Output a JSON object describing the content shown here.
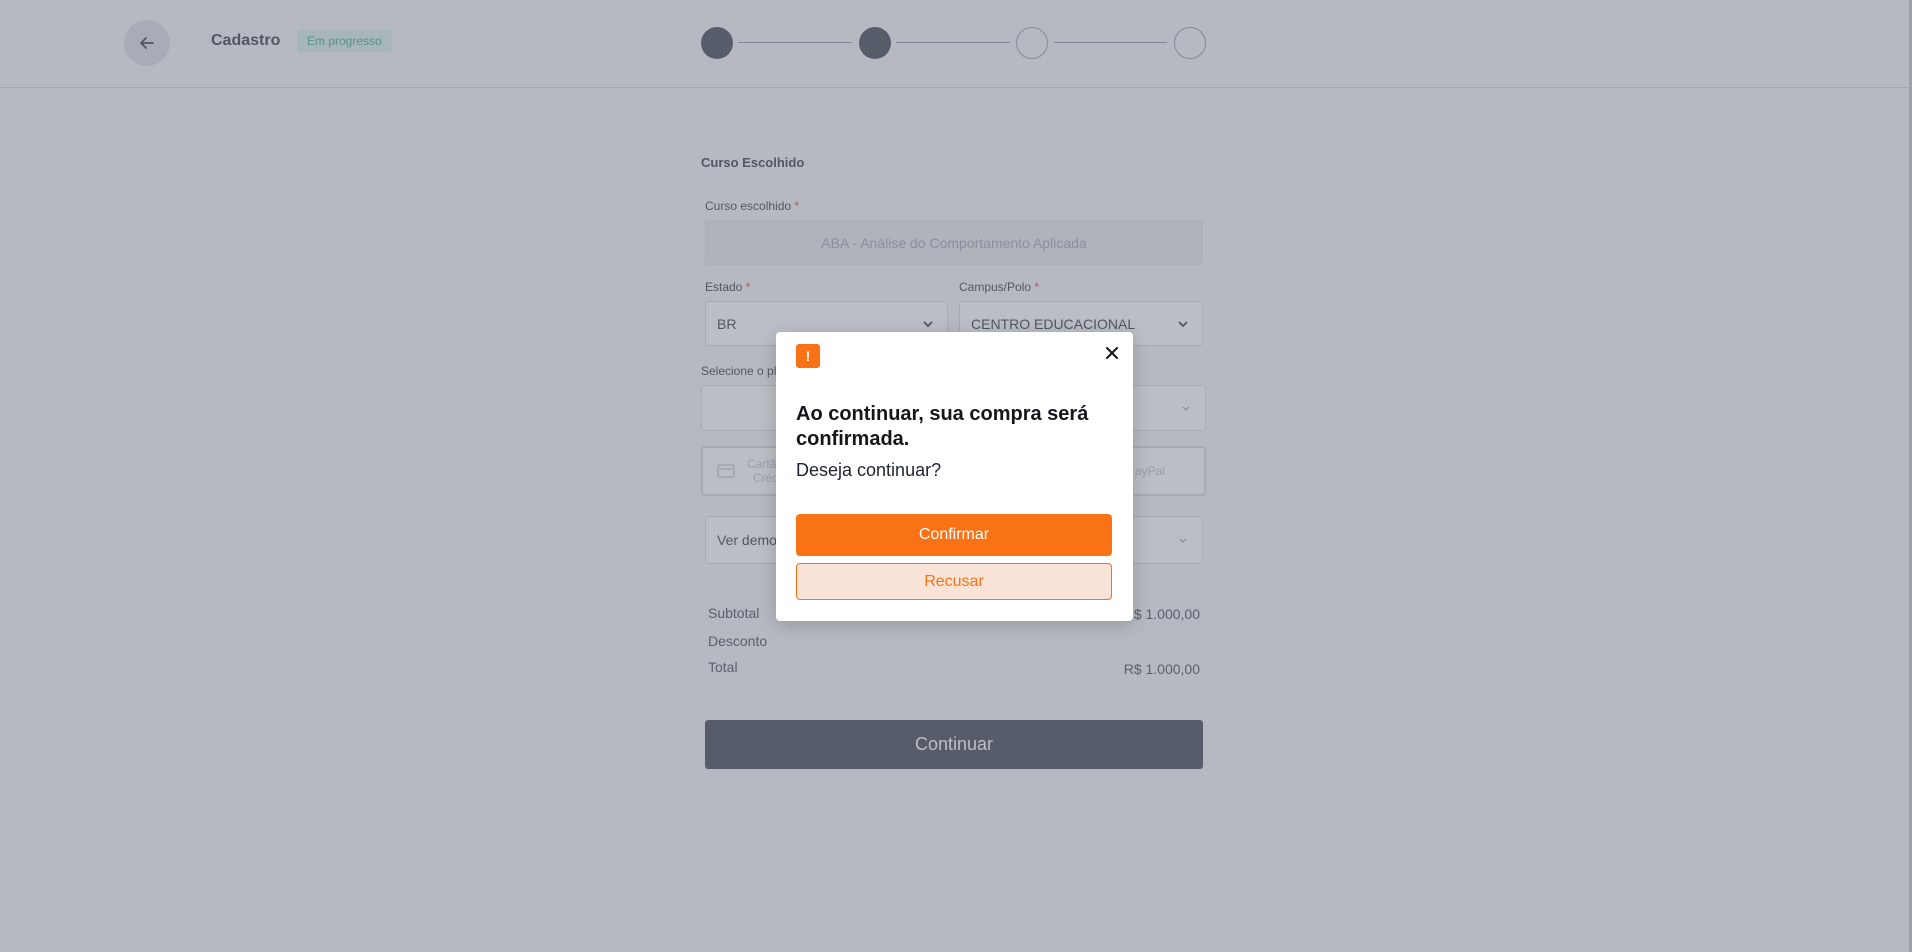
{
  "header": {
    "title": "Cadastro",
    "status": "Em progresso",
    "steps": [
      "done",
      "done",
      "todo",
      "todo"
    ]
  },
  "form": {
    "section_title": "Curso Escolhido",
    "course_label": "Curso escolhido",
    "required_mark": "*",
    "course_value": "ABA - Análise do Comportamento Aplicada",
    "state_label": "Estado",
    "state_value": "BR",
    "campus_label": "Campus/Polo",
    "campus_value": "CENTRO EDUCACIONAL",
    "plan_label_partial": "Selecione o pl",
    "payment_credit_partial_line1": "Cartã",
    "payment_credit_partial_line2": "Créd",
    "payment_paypal_partial": "ayPal",
    "demo_partial": "Ver demo"
  },
  "summary": {
    "subtotal_label": "Subtotal",
    "subtotal_value_partial": "R$ 1.000,00",
    "discount_label": "Desconto",
    "total_label": "Total",
    "total_value": "R$ 1.000,00"
  },
  "continue_label": "Continuar",
  "modal": {
    "icon_glyph": "!",
    "title": "Ao continuar, sua compra será confirmada.",
    "text": "Deseja continuar?",
    "confirm_label": "Confirmar",
    "decline_label": "Recusar"
  },
  "colors": {
    "accent": "#f97316",
    "dark": "#363b48",
    "badge_bg": "#d6efe8",
    "badge_text": "#3aa584"
  }
}
